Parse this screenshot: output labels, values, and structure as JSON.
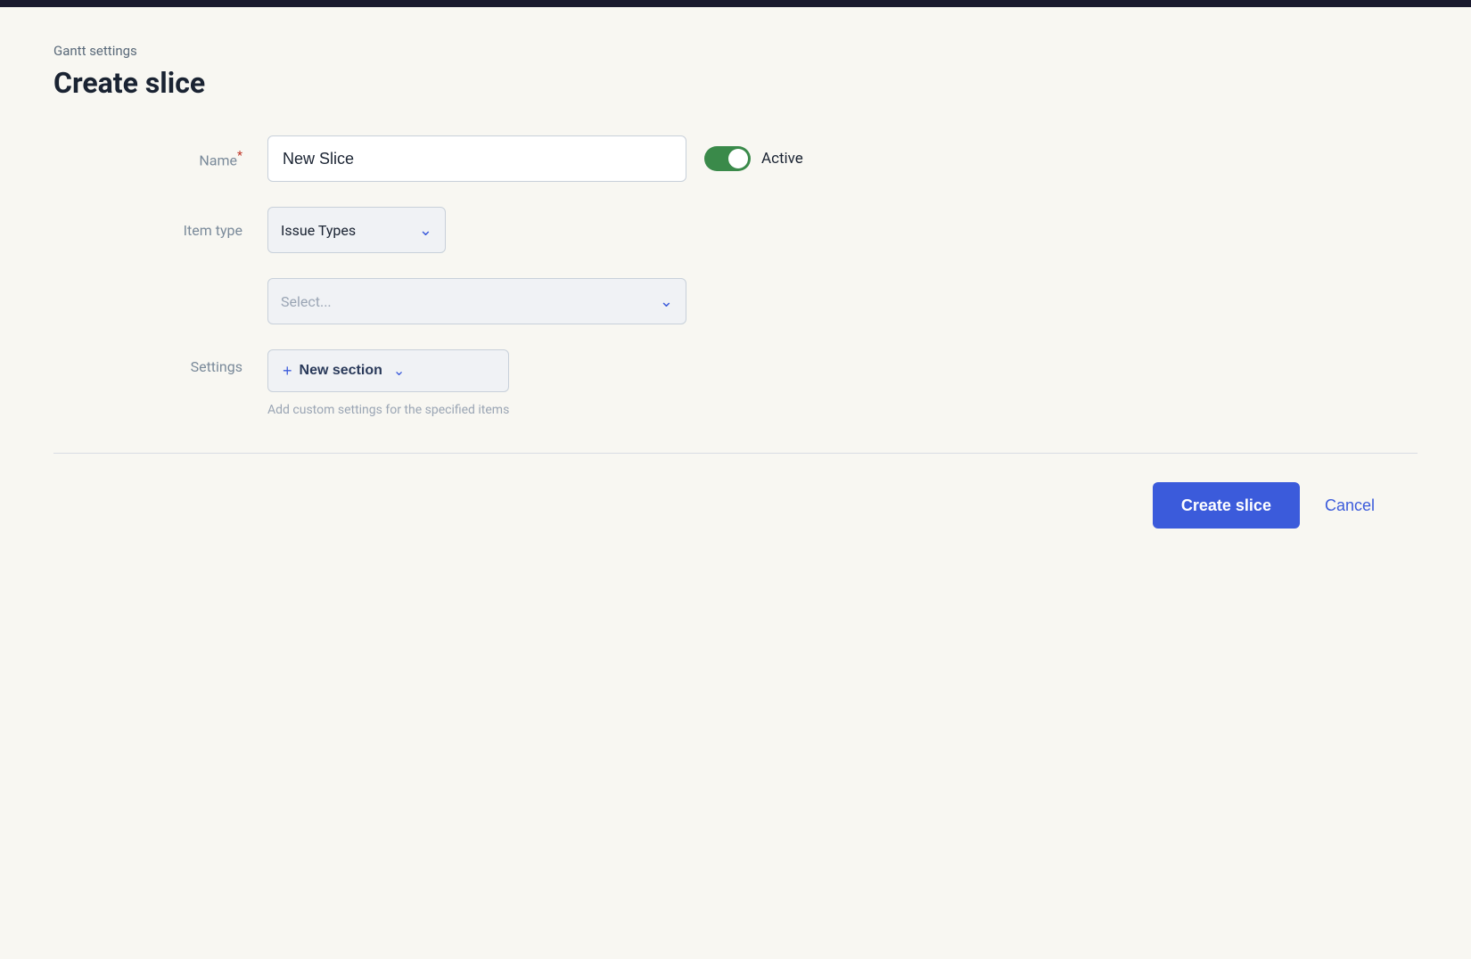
{
  "topBar": {},
  "breadcrumb": {
    "text": "Gantt settings"
  },
  "pageTitle": {
    "text": "Create slice"
  },
  "form": {
    "nameLabel": "Name",
    "nameRequired": "*",
    "nameValue": "New Slice",
    "activeLabel": "Active",
    "itemTypeLabel": "Item type",
    "itemTypeValue": "Issue Types",
    "selectPlaceholder": "Select...",
    "settingsLabel": "Settings",
    "newSectionLabel": "New section",
    "settingsHint": "Add custom settings for the specified items"
  },
  "footer": {
    "createBtnLabel": "Create slice",
    "cancelBtnLabel": "Cancel"
  },
  "icons": {
    "chevronDown": "⌄",
    "plus": "+",
    "chevronSmall": "⌄"
  }
}
